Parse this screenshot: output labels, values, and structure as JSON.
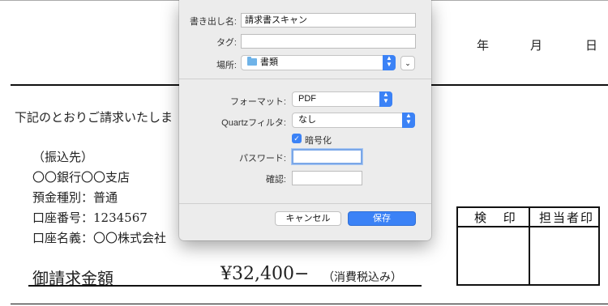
{
  "document": {
    "date": {
      "year": "年",
      "month": "月",
      "day": "日"
    },
    "intro": "下記のとおりご請求いたしま",
    "bank": {
      "heading": "（振込先）",
      "branch": "〇〇銀行〇〇支店",
      "type": "預金種別：普通",
      "number": "口座番号：1234567",
      "holder": "口座名義：〇〇株式会社"
    },
    "amount": {
      "label": "御請求金額",
      "value": "¥32,400−",
      "note": "（消費税込み）"
    },
    "stamps": {
      "inspect": "検 印",
      "person": "担当者印"
    }
  },
  "save_sheet": {
    "name_label": "書き出し名:",
    "name_value": "請求書スキャン",
    "tags_label": "タグ:",
    "tags_value": "",
    "where_label": "場所:",
    "where_value": "書類",
    "format_label": "フォーマット:",
    "format_value": "PDF",
    "quartz_label": "Quartzフィルタ:",
    "quartz_value": "なし",
    "encrypt_label": "暗号化",
    "encrypt_checked": true,
    "password_label": "パスワード:",
    "password_value": "",
    "verify_label": "確認:",
    "verify_value": "",
    "cancel_label": "キャンセル",
    "save_label": "保存",
    "expand_icon": "chevron-down-icon",
    "folder_icon": "folder-icon",
    "accent": "#3b82f6"
  }
}
